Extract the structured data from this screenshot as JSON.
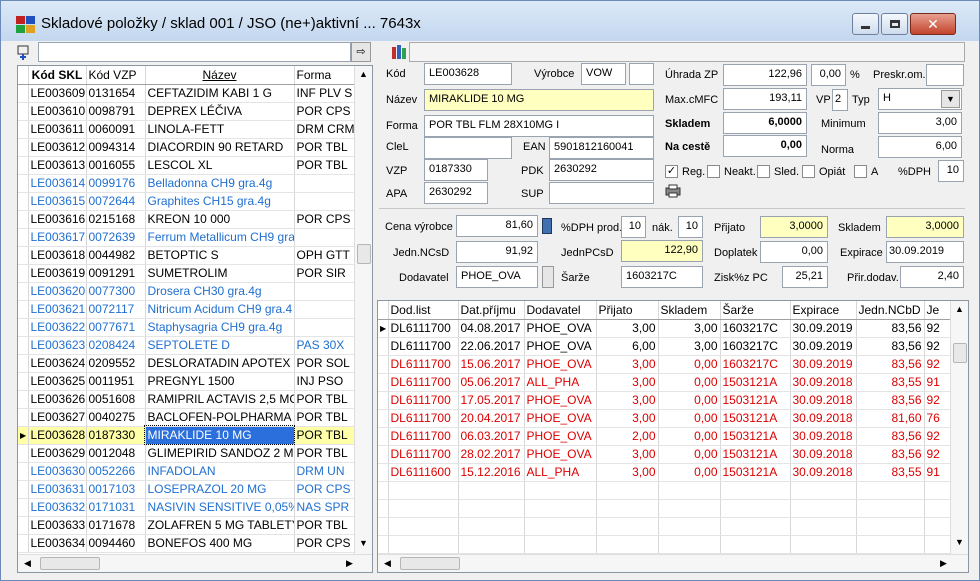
{
  "window": {
    "title": "Skladové položky / sklad 001 / JSO (ne+)aktivní  ... 7643x"
  },
  "left_table": {
    "columns": [
      "Kód SKL",
      "Kód VZP",
      "Název",
      "Forma"
    ],
    "rows": [
      {
        "skl": "LE003609",
        "vzp": "0131654",
        "nazev": "CEFTAZIDIM KABI 1 G",
        "forma": "INF PLV S",
        "style": ""
      },
      {
        "skl": "LE003610",
        "vzp": "0098791",
        "nazev": "DEPREX LÉČIVA",
        "forma": "POR CPS",
        "style": ""
      },
      {
        "skl": "LE003611",
        "vzp": "0060091",
        "nazev": "LINOLA-FETT",
        "forma": "DRM CRM",
        "style": ""
      },
      {
        "skl": "LE003612",
        "vzp": "0094314",
        "nazev": "DIACORDIN 90 RETARD",
        "forma": "POR TBL",
        "style": ""
      },
      {
        "skl": "LE003613",
        "vzp": "0016055",
        "nazev": "LESCOL XL",
        "forma": "POR TBL",
        "style": ""
      },
      {
        "skl": "LE003614",
        "vzp": "0099176",
        "nazev": "Belladonna CH9 gra.4g",
        "forma": "",
        "style": "blue"
      },
      {
        "skl": "LE003615",
        "vzp": "0072644",
        "nazev": "Graphites CH15 gra.4g",
        "forma": "",
        "style": "blue"
      },
      {
        "skl": "LE003616",
        "vzp": "0215168",
        "nazev": "KREON 10 000",
        "forma": "POR CPS",
        "style": ""
      },
      {
        "skl": "LE003617",
        "vzp": "0072639",
        "nazev": "Ferrum Metallicum CH9 gra",
        "forma": "",
        "style": "blue"
      },
      {
        "skl": "LE003618",
        "vzp": "0044982",
        "nazev": "BETOPTIC S",
        "forma": "OPH GTT",
        "style": ""
      },
      {
        "skl": "LE003619",
        "vzp": "0091291",
        "nazev": "SUMETROLIM",
        "forma": "POR SIR",
        "style": ""
      },
      {
        "skl": "LE003620",
        "vzp": "0077300",
        "nazev": "Drosera CH30 gra.4g",
        "forma": "",
        "style": "blue"
      },
      {
        "skl": "LE003621",
        "vzp": "0072117",
        "nazev": "Nitricum Acidum CH9 gra.4",
        "forma": "",
        "style": "blue"
      },
      {
        "skl": "LE003622",
        "vzp": "0077671",
        "nazev": "Staphysagria CH9 gra.4g",
        "forma": "",
        "style": "blue"
      },
      {
        "skl": "LE003623",
        "vzp": "0208424",
        "nazev": "SEPTOLETE D",
        "forma": "PAS 30X",
        "style": "blue"
      },
      {
        "skl": "LE003624",
        "vzp": "0209552",
        "nazev": "DESLORATADIN APOTEX 0",
        "forma": "POR SOL",
        "style": ""
      },
      {
        "skl": "LE003625",
        "vzp": "0011951",
        "nazev": "PREGNYL 1500",
        "forma": "INJ PSO",
        "style": ""
      },
      {
        "skl": "LE003626",
        "vzp": "0051608",
        "nazev": "RAMIPRIL ACTAVIS 2,5 MG",
        "forma": "POR TBL",
        "style": ""
      },
      {
        "skl": "LE003627",
        "vzp": "0040275",
        "nazev": "BACLOFEN-POLPHARMA 2",
        "forma": "POR TBL",
        "style": ""
      },
      {
        "skl": "LE003628",
        "vzp": "0187330",
        "nazev": "MIRAKLIDE 10 MG",
        "forma": "POR TBL",
        "style": "sel"
      },
      {
        "skl": "LE003629",
        "vzp": "0012048",
        "nazev": "GLIMEPIRID SANDOZ 2 MG",
        "forma": "POR TBL",
        "style": ""
      },
      {
        "skl": "LE003630",
        "vzp": "0052266",
        "nazev": "INFADOLAN",
        "forma": "DRM UN",
        "style": "blue"
      },
      {
        "skl": "LE003631",
        "vzp": "0017103",
        "nazev": "LOSEPRAZOL 20 MG",
        "forma": "POR CPS",
        "style": "blue"
      },
      {
        "skl": "LE003632",
        "vzp": "0171031",
        "nazev": "NASIVIN SENSITIVE 0,05%",
        "forma": "NAS SPR",
        "style": "blue"
      },
      {
        "skl": "LE003633",
        "vzp": "0171678",
        "nazev": "ZOLAFREN 5 MG TABLETY",
        "forma": "POR TBL",
        "style": ""
      },
      {
        "skl": "LE003634",
        "vzp": "0094460",
        "nazev": "BONEFOS 400 MG",
        "forma": "POR CPS",
        "style": ""
      }
    ]
  },
  "detail": {
    "kod_label": "Kód",
    "kod": "LE003628",
    "vyrobce_label": "Výrobce",
    "vyrobce": "VOW",
    "nazev_label": "Název",
    "nazev": "MIRAKLIDE 10 MG",
    "forma_label": "Forma",
    "forma": "POR TBL FLM 28X10MG I",
    "clel_label": "CleL",
    "ean_label": "EAN",
    "ean": "5901812160041",
    "vzp_label": "VZP",
    "vzp": "0187330",
    "pdk_label": "PDK",
    "pdk": "2630292",
    "apa_label": "APA",
    "apa": "2630292",
    "sup_label": "SUP",
    "uhrada_label": "Úhrada ZP",
    "uhrada": "122,96",
    "uhrada_pct": "0,00",
    "pct_sign": "%",
    "preskr_label": "Preskr.om.",
    "maxcmfc_label": "Max.cMFC",
    "maxcmfc": "193,11",
    "vp_label": "VP",
    "vp": "2",
    "typ_label": "Typ",
    "typ": "H",
    "skladem_label": "Skladem",
    "skladem": "6,0000",
    "minimum_label": "Minimum",
    "minimum": "3,00",
    "nacest_label": "Na cestě",
    "nacest": "0,00",
    "norma_label": "Norma",
    "norma": "6,00",
    "reg_label": "Reg.",
    "neakt_label": "Neakt.",
    "sled_label": "Sled.",
    "opiat_label": "Opiát",
    "a_label": "A",
    "dph_label": "%DPH",
    "dph": "10",
    "cenav_label": "Cena výrobce",
    "cenav": "81,60",
    "dphprod_label": "%DPH prod.",
    "dphprod": "10",
    "nak_label": "nák.",
    "nak": "10",
    "prijato_label": "Přijato",
    "prijato": "3,0000",
    "skladem2_label": "Skladem",
    "skladem2": "3,0000",
    "ncsd_label": "Jedn.NCsD",
    "ncsd": "91,92",
    "pcsd_label": "JednPCsD",
    "pcsd": "122,90",
    "doplatek_label": "Doplatek",
    "doplatek": "0,00",
    "expirace_label": "Expirace",
    "expirace": "30.09.2019",
    "dodavatel_label": "Dodavatel",
    "dodavatel": "PHOE_OVA",
    "sarze_label": "Šarže",
    "sarze": "1603217C",
    "zisk_label": "Zisk%z PC",
    "zisk": "25,21",
    "prir_label": "Přir.dodav.",
    "prir": "2,40"
  },
  "lower_table": {
    "columns": [
      "Dod.list",
      "Dat.příjmu",
      "Dodavatel",
      "Přijato",
      "Skladem",
      "Šarže",
      "Expirace",
      "Jedn.NCbD",
      "Je"
    ],
    "rows": [
      {
        "dl": "DL6111700",
        "dat": "04.08.2017",
        "dod": "PHOE_OVA",
        "prij": "3,00",
        "skl": "3,00",
        "sarze": "1603217C",
        "exp": "30.09.2019",
        "nc": "83,56",
        "je": "92",
        "style": "cur"
      },
      {
        "dl": "DL6111700",
        "dat": "22.06.2017",
        "dod": "PHOE_OVA",
        "prij": "6,00",
        "skl": "3,00",
        "sarze": "1603217C",
        "exp": "30.09.2019",
        "nc": "83,56",
        "je": "92",
        "style": ""
      },
      {
        "dl": "DL6111700",
        "dat": "15.06.2017",
        "dod": "PHOE_OVA",
        "prij": "3,00",
        "skl": "0,00",
        "sarze": "1603217C",
        "exp": "30.09.2019",
        "nc": "83,56",
        "je": "92",
        "style": "red"
      },
      {
        "dl": "DL6111700",
        "dat": "05.06.2017",
        "dod": "ALL_PHA",
        "prij": "3,00",
        "skl": "0,00",
        "sarze": "1503121A",
        "exp": "30.09.2018",
        "nc": "83,55",
        "je": "91",
        "style": "red"
      },
      {
        "dl": "DL6111700",
        "dat": "17.05.2017",
        "dod": "PHOE_OVA",
        "prij": "3,00",
        "skl": "0,00",
        "sarze": "1503121A",
        "exp": "30.09.2018",
        "nc": "83,56",
        "je": "92",
        "style": "red"
      },
      {
        "dl": "DL6111700",
        "dat": "20.04.2017",
        "dod": "PHOE_OVA",
        "prij": "3,00",
        "skl": "0,00",
        "sarze": "1503121A",
        "exp": "30.09.2018",
        "nc": "81,60",
        "je": "76",
        "style": "red"
      },
      {
        "dl": "DL6111700",
        "dat": "06.03.2017",
        "dod": "PHOE_OVA",
        "prij": "2,00",
        "skl": "0,00",
        "sarze": "1503121A",
        "exp": "30.09.2018",
        "nc": "83,56",
        "je": "92",
        "style": "red"
      },
      {
        "dl": "DL6111700",
        "dat": "28.02.2017",
        "dod": "PHOE_OVA",
        "prij": "3,00",
        "skl": "0,00",
        "sarze": "1503121A",
        "exp": "30.09.2018",
        "nc": "83,56",
        "je": "92",
        "style": "red"
      },
      {
        "dl": "DL6111600",
        "dat": "15.12.2016",
        "dod": "ALL_PHA",
        "prij": "3,00",
        "skl": "0,00",
        "sarze": "1503121A",
        "exp": "30.09.2018",
        "nc": "83,55",
        "je": "91",
        "style": "red"
      }
    ]
  }
}
